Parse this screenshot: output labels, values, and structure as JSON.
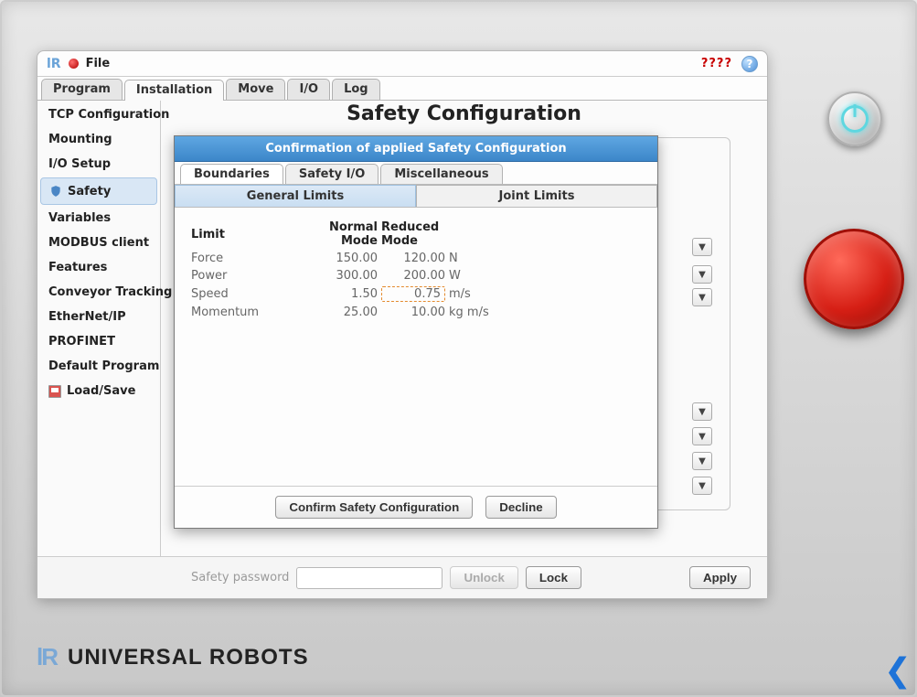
{
  "titlebar": {
    "file_label": "File",
    "status_text": "????"
  },
  "main_tabs": [
    "Program",
    "Installation",
    "Move",
    "I/O",
    "Log"
  ],
  "main_tabs_active": 1,
  "sidebar": {
    "items": [
      "TCP Configuration",
      "Mounting",
      "I/O Setup",
      "Safety",
      "Variables",
      "MODBUS client",
      "Features",
      "Conveyor Tracking",
      "EtherNet/IP",
      "PROFINET",
      "Default Program",
      "Load/Save"
    ],
    "active_index": 3
  },
  "page_title": "Safety Configuration",
  "footer": {
    "password_label": "Safety password",
    "unlock": "Unlock",
    "lock": "Lock",
    "apply": "Apply"
  },
  "dialog": {
    "title": "Confirmation of applied Safety Configuration",
    "tabs1": [
      "Boundaries",
      "Safety I/O",
      "Miscellaneous"
    ],
    "tabs1_active": 0,
    "tabs2": [
      "General Limits",
      "Joint Limits"
    ],
    "tabs2_active": 0,
    "columns": {
      "limit": "Limit",
      "normal": "Normal Mode",
      "reduced": "Reduced Mode"
    },
    "rows": [
      {
        "name": "Force",
        "normal": "150.00",
        "reduced": "120.00",
        "unit": "N"
      },
      {
        "name": "Power",
        "normal": "300.00",
        "reduced": "200.00",
        "unit": "W"
      },
      {
        "name": "Speed",
        "normal": "1.50",
        "reduced": "0.75",
        "unit": "m/s",
        "highlight": true
      },
      {
        "name": "Momentum",
        "normal": "25.00",
        "reduced": "10.00",
        "unit": "kg m/s"
      }
    ],
    "confirm": "Confirm Safety Configuration",
    "decline": "Decline"
  },
  "brand": "UNIVERSAL ROBOTS"
}
